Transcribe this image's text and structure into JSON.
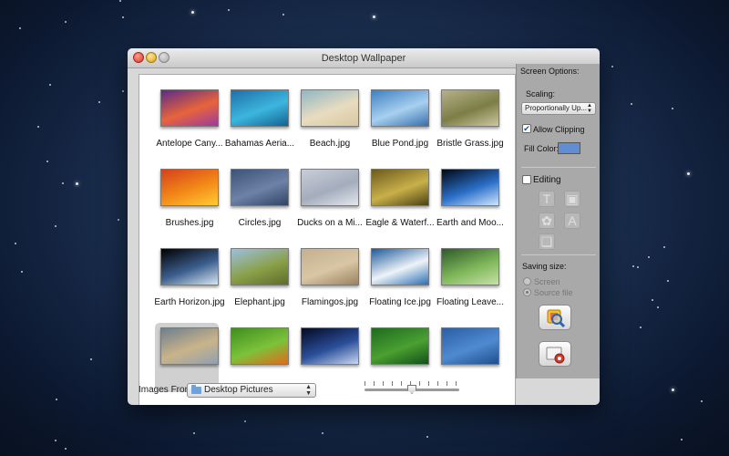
{
  "window": {
    "title": "Desktop Wallpaper"
  },
  "thumbnails": [
    {
      "label": "Antelope Cany...",
      "colors": [
        "#5a2a8a",
        "#e8643a",
        "#9a3aa0"
      ]
    },
    {
      "label": "Bahamas Aeria...",
      "colors": [
        "#1f6fa6",
        "#3cb6de",
        "#136390"
      ]
    },
    {
      "label": "Beach.jpg",
      "colors": [
        "#8fb6c4",
        "#e8dcc0",
        "#d8c8a0"
      ]
    },
    {
      "label": "Blue Pond.jpg",
      "colors": [
        "#3f7fc2",
        "#a8d0ef",
        "#3570ad"
      ]
    },
    {
      "label": "Bristle Grass.jpg",
      "colors": [
        "#b5b18a",
        "#7c7e45",
        "#cdc7a2"
      ]
    },
    {
      "label": "Brushes.jpg",
      "colors": [
        "#d6401b",
        "#f38a18",
        "#ffcc33"
      ]
    },
    {
      "label": "Circles.jpg",
      "colors": [
        "#3d5277",
        "#6d82a6",
        "#2f4466"
      ]
    },
    {
      "label": "Ducks on a Mi...",
      "colors": [
        "#c8ced8",
        "#a4adbd",
        "#e4e6ea"
      ]
    },
    {
      "label": "Eagle & Waterf...",
      "colors": [
        "#6b5a1c",
        "#c9b04a",
        "#4a4214"
      ]
    },
    {
      "label": "Earth and Moo...",
      "colors": [
        "#000814",
        "#2a6fc8",
        "#cfe6ff"
      ]
    },
    {
      "label": "Earth Horizon.jpg",
      "colors": [
        "#000000",
        "#3c5f8e",
        "#d8e6f2"
      ]
    },
    {
      "label": "Elephant.jpg",
      "colors": [
        "#9cc0e0",
        "#8aa048",
        "#5e6c2a"
      ]
    },
    {
      "label": "Flamingos.jpg",
      "colors": [
        "#c4b090",
        "#d9c6a4",
        "#9a8260"
      ]
    },
    {
      "label": "Floating Ice.jpg",
      "colors": [
        "#1e5a9c",
        "#eef3f8",
        "#2a6fb5"
      ]
    },
    {
      "label": "Floating Leave...",
      "colors": [
        "#2e5a2a",
        "#7fb85a",
        "#c8e0a8"
      ]
    },
    {
      "label": "",
      "colors": [
        "#6e7e8e",
        "#c9b48a",
        "#8fa0b0"
      ]
    },
    {
      "label": "",
      "colors": [
        "#3f8e1e",
        "#7cc23a",
        "#e06a1a"
      ]
    },
    {
      "label": "",
      "colors": [
        "#030a24",
        "#2b4f9a",
        "#c8d6f0"
      ]
    },
    {
      "label": "",
      "colors": [
        "#1d6b1f",
        "#4aa030",
        "#12501a"
      ]
    },
    {
      "label": "",
      "colors": [
        "#2a5fa4",
        "#4f8ad0",
        "#1e4f8e"
      ]
    }
  ],
  "selected_index": 15,
  "bottom_bar": {
    "images_from_label": "Images From:",
    "source": "Desktop Pictures",
    "thumbnail_size_level": 0.5
  },
  "side_panel": {
    "header": "Screen Options:",
    "scaling_label": "Scaling:",
    "scaling_value": "Proportionally Up...",
    "allow_clipping_label": "Allow Clipping",
    "allow_clipping_checked": true,
    "fill_color_label": "Fill Color:",
    "fill_color": "#5f8fd2",
    "editing_label": "Editing",
    "editing_checked": false,
    "saving_size_label": "Saving size:",
    "screen_option": "Screen",
    "source_file_option": "Source file",
    "selected_saving_size": "Source file"
  }
}
